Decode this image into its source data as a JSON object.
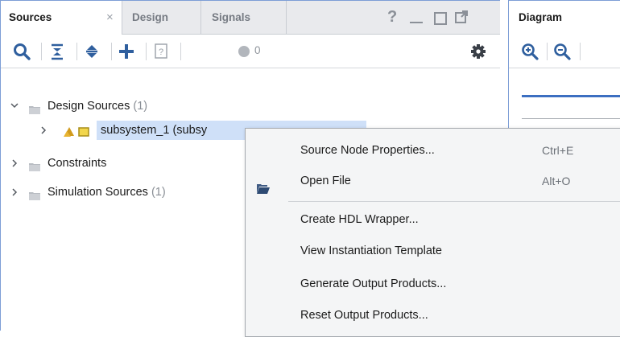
{
  "sources_panel": {
    "tabs": [
      {
        "label": "Sources",
        "active": true
      },
      {
        "label": "Design",
        "active": false
      },
      {
        "label": "Signals",
        "active": false
      }
    ],
    "close_glyph": "×",
    "help_glyph": "?",
    "toolbar": {
      "issue_count": "0"
    },
    "tree": [
      {
        "label": "Design Sources",
        "count": "(1)",
        "expanded": true
      },
      {
        "label": "subsystem_1 (subsy",
        "count": "",
        "expanded": false,
        "selected": true
      },
      {
        "label": "Constraints",
        "count": "",
        "expanded": false
      },
      {
        "label": "Simulation Sources",
        "count": "(1)",
        "expanded": false
      }
    ]
  },
  "diagram_panel": {
    "tab_label": "Diagram"
  },
  "context_menu": {
    "items": [
      {
        "label": "Source Node Properties...",
        "shortcut": "Ctrl+E"
      },
      {
        "label": "Open File",
        "shortcut": "Alt+O",
        "icon": "folder-open-icon"
      },
      {
        "label": "Create HDL Wrapper...",
        "shortcut": ""
      },
      {
        "label": "View Instantiation Template",
        "shortcut": ""
      },
      {
        "label": "Generate Output Products...",
        "shortcut": ""
      },
      {
        "label": "Reset Output Products...",
        "shortcut": ""
      }
    ]
  },
  "colors": {
    "accent_border": "#7d9ed6",
    "selection": "#cfe0f8",
    "toolbar_icon": "#2f5f9e",
    "gear": "#3a3f47"
  }
}
